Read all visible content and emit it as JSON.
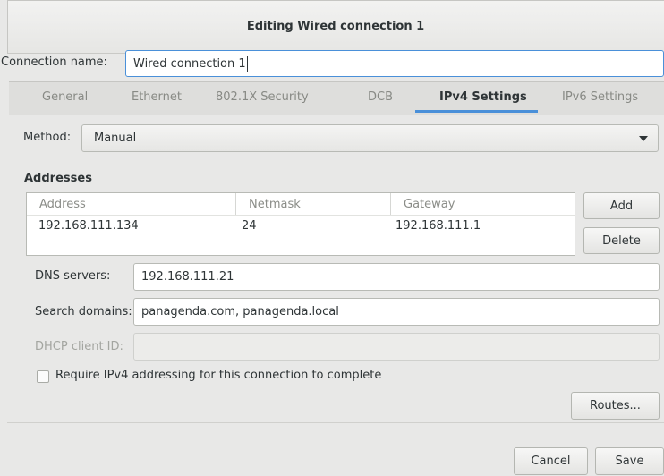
{
  "window": {
    "title": "Editing Wired connection 1"
  },
  "connection": {
    "label": "Connection name:",
    "value": "Wired connection 1"
  },
  "tabs": [
    {
      "label": "General",
      "active": false
    },
    {
      "label": "Ethernet",
      "active": false
    },
    {
      "label": "802.1X Security",
      "active": false
    },
    {
      "label": "DCB",
      "active": false
    },
    {
      "label": "IPv4 Settings",
      "active": true
    },
    {
      "label": "IPv6 Settings",
      "active": false
    }
  ],
  "method": {
    "label": "Method:",
    "value": "Manual"
  },
  "addresses": {
    "heading": "Addresses",
    "columns": [
      "Address",
      "Netmask",
      "Gateway"
    ],
    "rows": [
      [
        "192.168.111.134",
        "24",
        "192.168.111.1"
      ]
    ],
    "add_label": "Add",
    "delete_label": "Delete"
  },
  "dns": {
    "label": "DNS servers:",
    "value": "192.168.111.21"
  },
  "search": {
    "label": "Search domains:",
    "value": "panagenda.com, panagenda.local"
  },
  "dhcp": {
    "label": "DHCP client ID:",
    "value": ""
  },
  "require": {
    "label": "Require IPv4 addressing for this connection to complete",
    "checked": false
  },
  "routes_label": "Routes...",
  "footer": {
    "cancel_label": "Cancel",
    "save_label": "Save"
  },
  "colors": {
    "accent": "#4a90d9",
    "window_bg": "#e8e8e7",
    "text": "#2e3436",
    "muted": "#888a85"
  },
  "icons": {
    "dropdown": "chevron-down-icon"
  }
}
